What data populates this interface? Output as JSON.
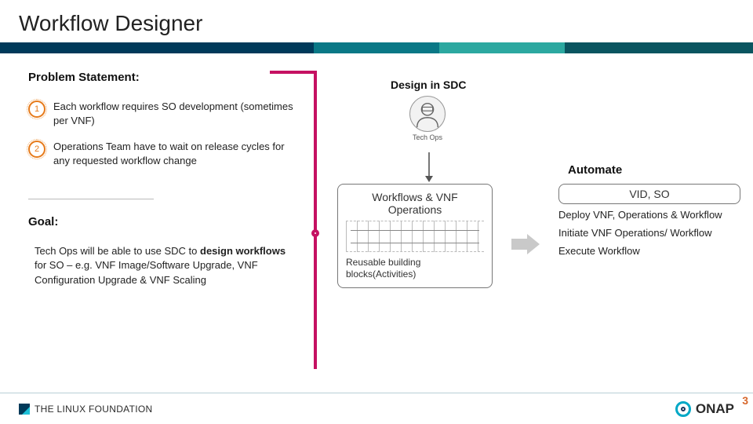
{
  "title": "Workflow Designer",
  "left": {
    "problem_heading": "Problem Statement:",
    "problems": [
      {
        "num": "1",
        "text": "Each workflow requires SO development (sometimes per VNF)"
      },
      {
        "num": "2",
        "text": "Operations Team have to wait on release cycles for any requested workflow change"
      }
    ],
    "goal_heading": "Goal:",
    "goal_prefix": "Tech Ops will be able to use SDC to ",
    "goal_bold": "design workflows",
    "goal_suffix": " for SO – e.g. VNF Image/Software Upgrade, VNF Configuration Upgrade & VNF Scaling"
  },
  "right": {
    "design_heading": "Design in SDC",
    "techops_label": "Tech Ops",
    "automate_label": "Automate",
    "card_left_title": "Workflows & VNF Operations",
    "card_left_sub": "Reusable building blocks(Activities)",
    "card_right_title": "VID, SO",
    "bullets": [
      "Deploy VNF, Operations & Workflow",
      "Initiate VNF Operations/ Workflow",
      "Execute Workflow"
    ]
  },
  "footer": {
    "linux_text": "THE LINUX FOUNDATION",
    "onap_text": "ONAP",
    "page_number": "3"
  },
  "colors": {
    "accent_pink": "#c51162",
    "accent_orange": "#e67a1a",
    "teal_dark": "#003a5a"
  }
}
